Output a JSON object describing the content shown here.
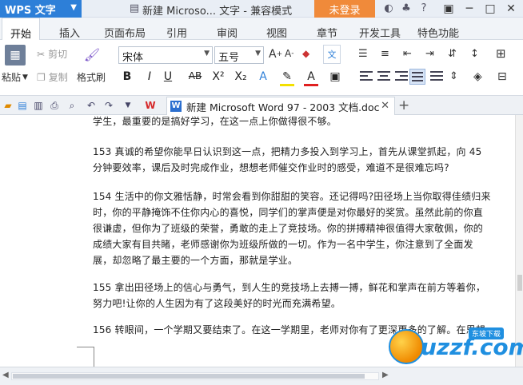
{
  "titlebar": {
    "app_name": "WPS 文字",
    "doc_title": "新建 Microso... 文字 - 兼容模式",
    "login_label": "未登录"
  },
  "menu": {
    "tabs": [
      "开始",
      "插入",
      "页面布局",
      "引用",
      "审阅",
      "视图",
      "章节",
      "开发工具",
      "特色功能"
    ],
    "active": "开始"
  },
  "ribbon": {
    "paste_label": "粘贴",
    "cut_label": "剪切",
    "copy_label": "复制",
    "format_painter_label": "格式刷",
    "font_name": "宋体",
    "font_size": "五号",
    "bold": "B",
    "italic": "I",
    "underline": "U",
    "strike": "AB",
    "superscript": "X²",
    "subscript": "X₂"
  },
  "doc_tab": {
    "name": "新建 Microsoft Word 97 - 2003 文档.doc"
  },
  "document": {
    "paragraphs": [
      "学生，最重要的是搞好学习，在这一点上你做得很不够。",
      "153 真诚的希望你能早日认识到这一点，把精力多投入到学习上，首先从课堂抓起，向 45 分钟要效率，课后及时完成作业，想想老师催交作业时的感受，难道不是很难忘吗?",
      "154 生活中的你文雅恬静，时常会看到你甜甜的笑容。还记得吗?田径场上当你取得佳绩归来时，你的平静掩饰不住你内心的喜悦，同学们的掌声便是对你最好的奖赏。虽然此前的你直很谦虚，但你为了班级的荣誉，勇敢的走上了竞技场。你的拼搏精神很值得大家敬佩，你的成绩大家有目共睹，老师感谢你为班级所做的一切。作为一名中学生，你注意到了全面发展，却忽略了最主要的一个方面，那就是学业。",
      "155 拿出田径场上的信心与勇气，到人生的竞技场上去搏一搏，鲜花和掌声在前方等着你，努力吧!让你的人生因为有了这段美好的时光而充满希望。",
      "156 转眼间，一个学期又要结束了。在这一学期里，老师对你有了更深更多的了解。在思想"
    ]
  },
  "watermark": {
    "logo_text": "uzzf.com",
    "badge": "东坡下载"
  },
  "colors": {
    "wps_blue": "#2d7fd8",
    "login_orange": "#f08a3a"
  }
}
